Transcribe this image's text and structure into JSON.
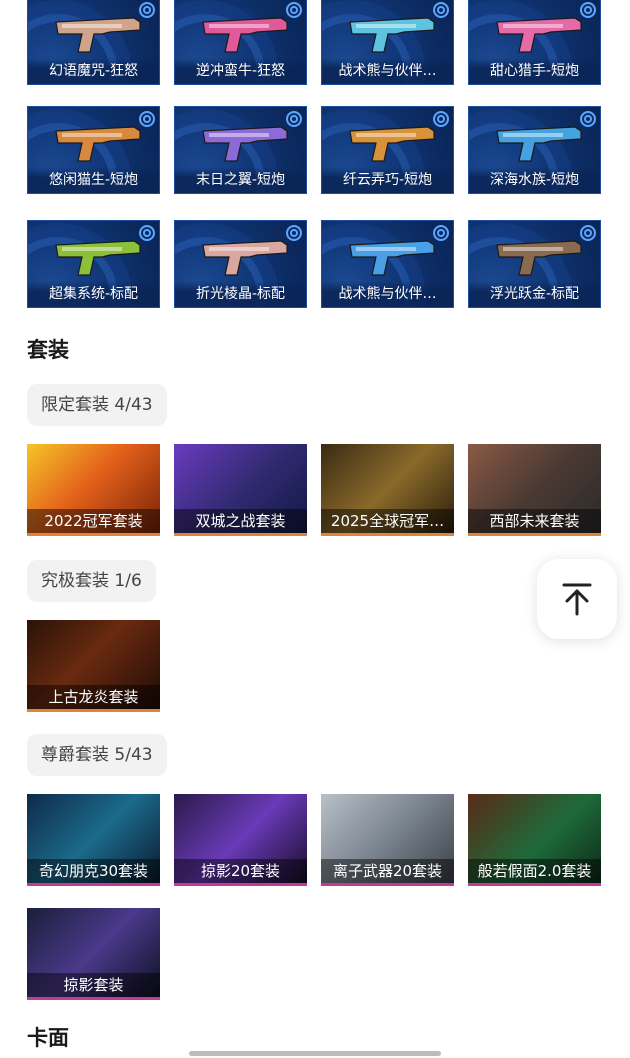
{
  "weapon_skins": [
    [
      {
        "label": "幻语魔咒-狂怒",
        "accent": "#cfa48a"
      },
      {
        "label": "逆冲蛮牛-狂怒",
        "accent": "#e05a9a"
      },
      {
        "label": "战术熊与伙伴…",
        "accent": "#5ec3e0"
      },
      {
        "label": "甜心猎手-短炮",
        "accent": "#e46aa8"
      }
    ],
    [
      {
        "label": "悠闲猫生-短炮",
        "accent": "#d7893f"
      },
      {
        "label": "末日之翼-短炮",
        "accent": "#8c6bd8"
      },
      {
        "label": "纤云弄巧-短炮",
        "accent": "#d8923a"
      },
      {
        "label": "深海水族-短炮",
        "accent": "#45a2e0"
      }
    ],
    [
      {
        "label": "超集系统-标配",
        "accent": "#8cbf3a"
      },
      {
        "label": "折光棱晶-标配",
        "accent": "#d9a7a0"
      },
      {
        "label": "战术熊与伙伴…",
        "accent": "#4aa0e6"
      },
      {
        "label": "浮光跃金-标配",
        "accent": "#8a6a50"
      }
    ]
  ],
  "bundles_title": "套装",
  "limited": {
    "chip": "限定套装 4/43",
    "items": [
      {
        "label": "2022冠军套装",
        "bg": "linear-gradient(135deg,#f6c52a 0%,#e3611a 45%,#7a2208 100%)"
      },
      {
        "label": "双城之战套装",
        "bg": "linear-gradient(135deg,#6a3bbf 0%,#2e2a6e 55%,#141845 100%)"
      },
      {
        "label": "2025全球冠军…",
        "bg": "linear-gradient(135deg,#3a2a12 0%,#8a6a2a 50%,#2a1e0c 100%)"
      },
      {
        "label": "西部未来套装",
        "bg": "linear-gradient(135deg,#8a5a44 0%,#4b3a34 50%,#2a2a2a 100%)"
      }
    ]
  },
  "ultimate": {
    "chip": "究极套装 1/6",
    "items": [
      {
        "label": "上古龙炎套装",
        "bg": "linear-gradient(135deg,#2a1208 0%,#6a2a10 45%,#1e0c06 100%)"
      }
    ]
  },
  "premium": {
    "chip": "尊爵套装 5/43",
    "items": [
      {
        "label": "奇幻朋克30套装",
        "bg": "linear-gradient(135deg,#0e2a4a 0%,#1c6a8a 50%,#0a1a30 100%)"
      },
      {
        "label": "掠影20套装",
        "bg": "linear-gradient(135deg,#2a1a4a 0%,#6a3ab8 50%,#180e2a 100%)"
      },
      {
        "label": "离子武器20套装",
        "bg": "linear-gradient(135deg,#b8c0c8 0%,#7a848e 50%,#3a4048 100%)"
      },
      {
        "label": "般若假面2.0套装",
        "bg": "linear-gradient(135deg,#5a2a18 0%,#1e6a3a 55%,#0e2a18 100%)"
      },
      {
        "label": "掠影套装",
        "bg": "linear-gradient(135deg,#1a1e3a 0%,#4a3a8a 50%,#0e1024 100%)"
      }
    ]
  },
  "cards_title": "卡面",
  "icons": {
    "back_to_top": "arrow-up-to-line-icon"
  }
}
